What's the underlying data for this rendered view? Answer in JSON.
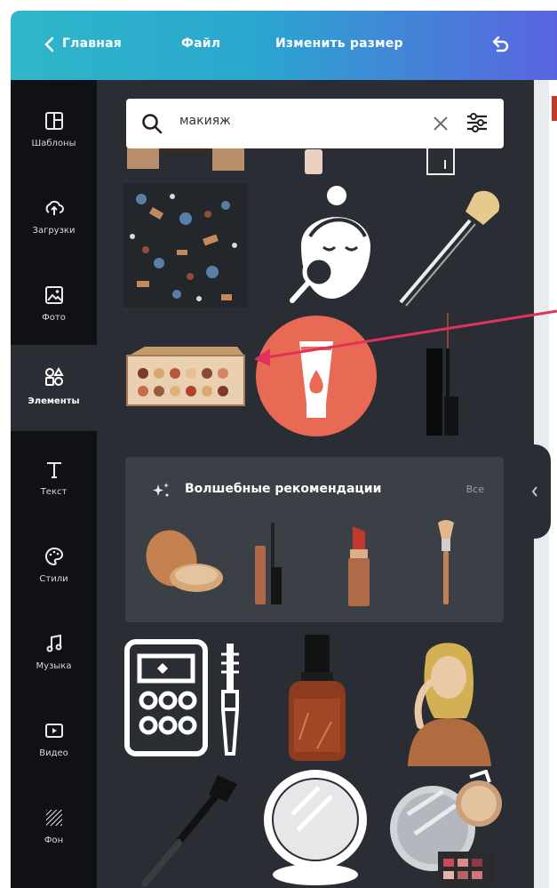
{
  "topbar": {
    "home_label": "Главная",
    "file_label": "Файл",
    "resize_label": "Изменить размер"
  },
  "sidebar": {
    "items": [
      {
        "label": "Шаблоны",
        "icon": "templates-icon"
      },
      {
        "label": "Загрузки",
        "icon": "upload-icon"
      },
      {
        "label": "Фото",
        "icon": "photo-icon"
      },
      {
        "label": "Элементы",
        "icon": "elements-icon",
        "active": true
      },
      {
        "label": "Текст",
        "icon": "text-icon"
      },
      {
        "label": "Стили",
        "icon": "palette-icon"
      },
      {
        "label": "Музыка",
        "icon": "music-icon"
      },
      {
        "label": "Видео",
        "icon": "video-icon"
      },
      {
        "label": "Фон",
        "icon": "background-icon"
      }
    ]
  },
  "search": {
    "value": "макияж"
  },
  "magic": {
    "title": "Волшебные рекомендации",
    "all_label": "Все"
  },
  "colors": {
    "accent_gradient_start": "#2fb7c9",
    "accent_gradient_end": "#5a64e0",
    "sidebar_bg": "#0f1114",
    "panel_bg": "#2a2d33",
    "annotation_arrow": "#e0325a"
  }
}
